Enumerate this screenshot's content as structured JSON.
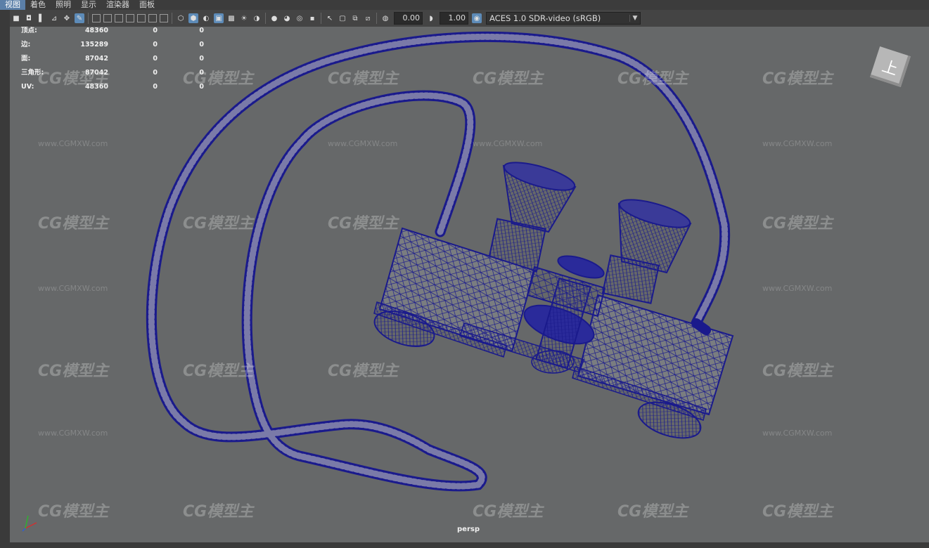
{
  "menu": {
    "items": [
      "视图",
      "着色",
      "照明",
      "显示",
      "渲染器",
      "面板"
    ]
  },
  "toolbar": {
    "exposure": "0.00",
    "gamma": "1.00",
    "color_space": "ACES 1.0 SDR-video (sRGB)"
  },
  "hud": {
    "rows": [
      {
        "label": "顶点:",
        "v1": "48360",
        "v2": "0",
        "v3": "0"
      },
      {
        "label": "边:",
        "v1": "135289",
        "v2": "0",
        "v3": "0"
      },
      {
        "label": "面:",
        "v1": "87042",
        "v2": "0",
        "v3": "0"
      },
      {
        "label": "三角形:",
        "v1": "87042",
        "v2": "0",
        "v3": "0"
      },
      {
        "label": "UV:",
        "v1": "48360",
        "v2": "0",
        "v3": "0"
      }
    ]
  },
  "viewcube": {
    "label": "上"
  },
  "camera": {
    "name": "persp"
  },
  "watermark": {
    "logo": "CG模型主",
    "url": "www.CGMXW.com"
  },
  "colors": {
    "wire": "#1a1a8c",
    "viewport_bg": "#666869",
    "accent": "#5b7fa8"
  }
}
